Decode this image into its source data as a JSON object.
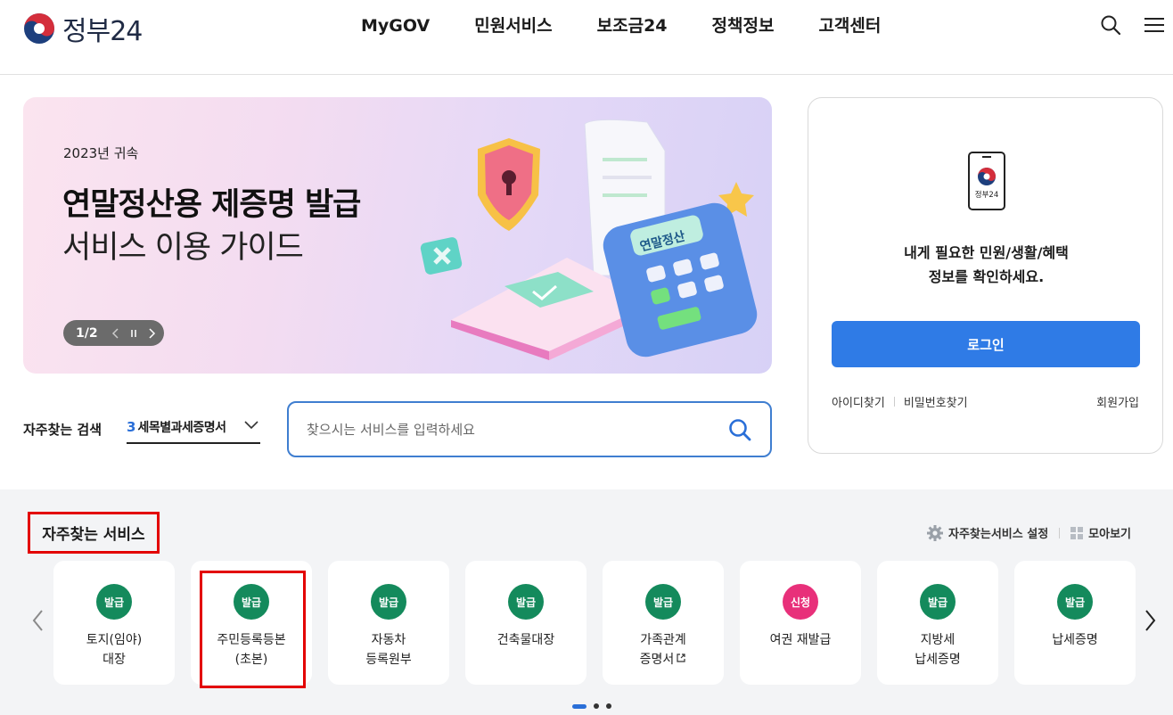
{
  "header": {
    "logo_text": "정부24",
    "nav": [
      "MyGOV",
      "민원서비스",
      "보조금24",
      "정책정보",
      "고객센터"
    ]
  },
  "banner": {
    "subtitle": "2023년 귀속",
    "title": "연말정산용 제증명 발급",
    "title2": "서비스 이용 가이드",
    "calculator_label": "연말정산",
    "pager": "1/2"
  },
  "search": {
    "label": "자주찾는 검색",
    "keyword_num": "3",
    "keyword_text": "세목별과세증명서",
    "placeholder": "찾으시는 서비스를 입력하세요"
  },
  "login": {
    "phone_label": "정부24",
    "message_line1": "내게 필요한 민원/생활/혜택",
    "message_line2": "정보를 확인하세요.",
    "button": "로그인",
    "find_id": "아이디찾기",
    "find_pw": "비밀번호찾기",
    "join": "회원가입"
  },
  "services": {
    "title": "자주찾는 서비스",
    "settings": "자주찾는서비스 설정",
    "view_all": "모아보기",
    "colors": {
      "issue": "#148a5c",
      "apply": "#e8307a",
      "accent": "#2a6fd8",
      "highlight": "#e30000"
    },
    "cards": [
      {
        "badge": "발급",
        "type": "issue",
        "line1": "토지(임야)",
        "line2": "대장"
      },
      {
        "badge": "발급",
        "type": "issue",
        "line1": "주민등록등본",
        "line2": "(초본)"
      },
      {
        "badge": "발급",
        "type": "issue",
        "line1": "자동차",
        "line2": "등록원부"
      },
      {
        "badge": "발급",
        "type": "issue",
        "line1": "건축물대장",
        "line2": ""
      },
      {
        "badge": "발급",
        "type": "issue",
        "line1": "가족관계",
        "line2": "증명서",
        "external": true
      },
      {
        "badge": "신청",
        "type": "apply",
        "line1": "여권 재발급",
        "line2": ""
      },
      {
        "badge": "발급",
        "type": "issue",
        "line1": "지방세",
        "line2": "납세증명"
      },
      {
        "badge": "발급",
        "type": "issue",
        "line1": "납세증명",
        "line2": ""
      }
    ]
  }
}
